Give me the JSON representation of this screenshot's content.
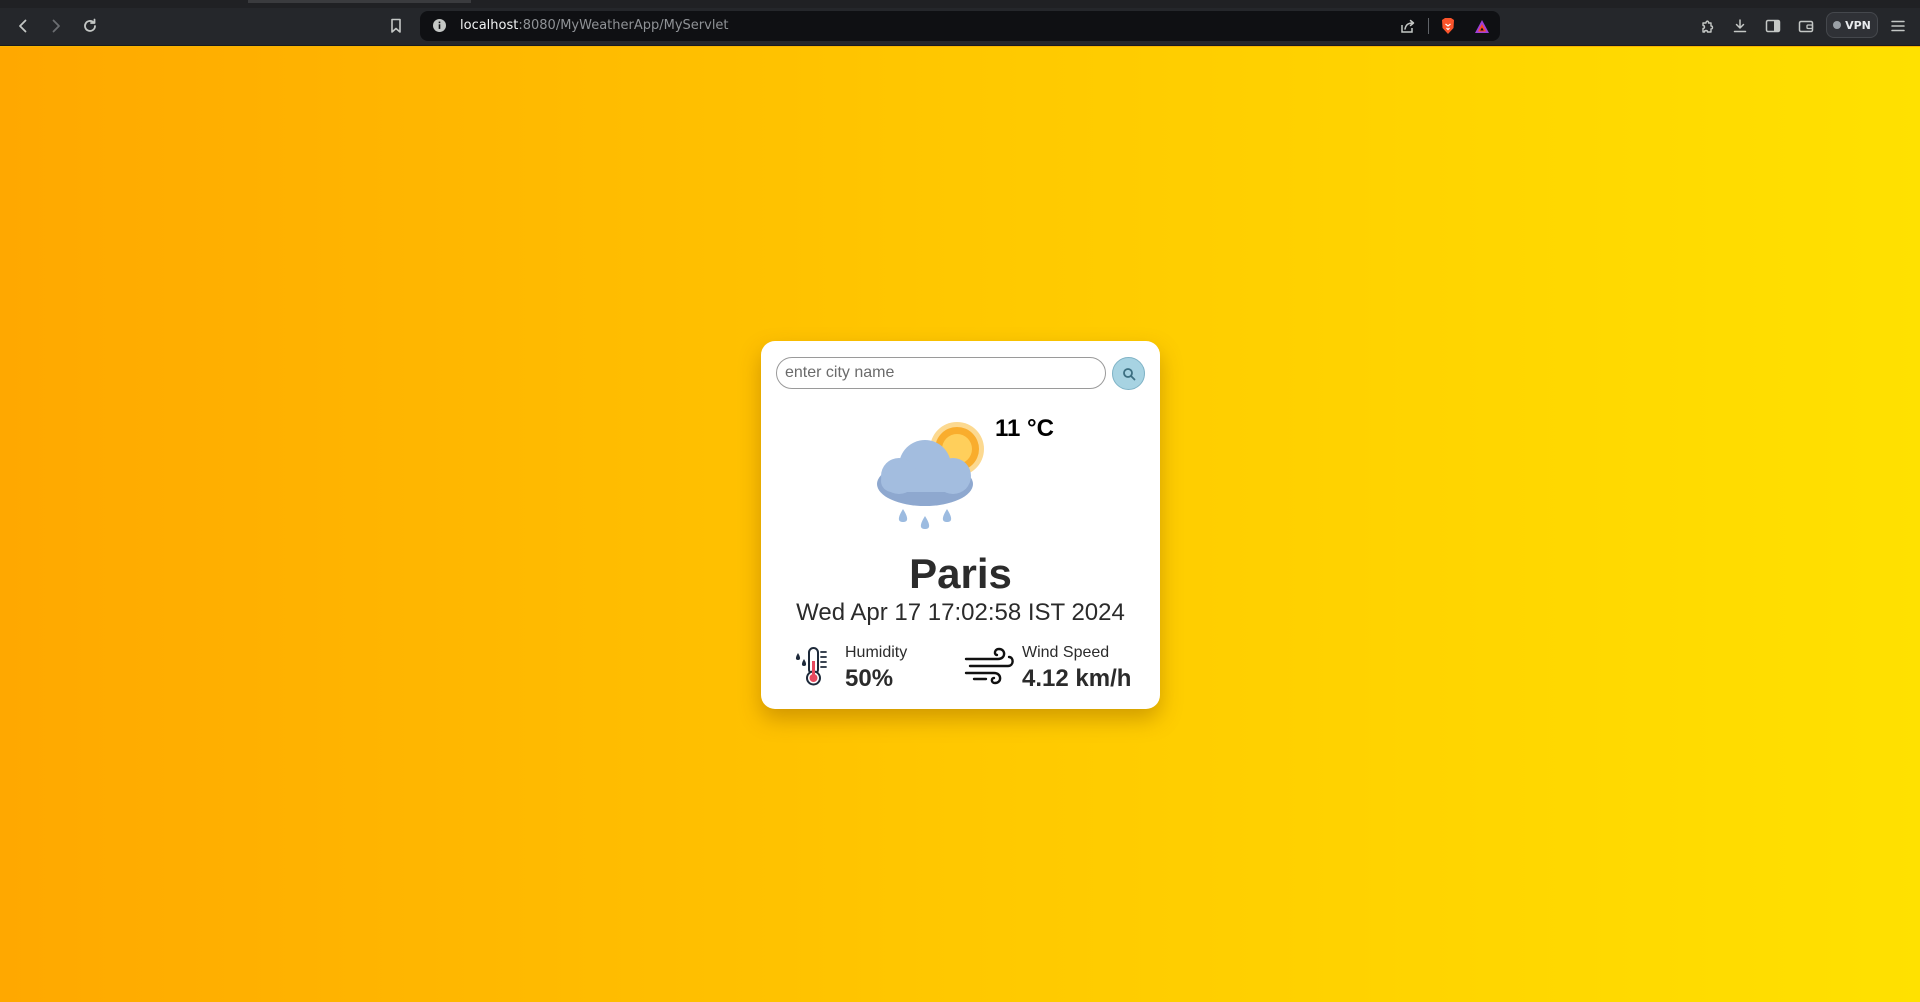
{
  "browser": {
    "url_host": "localhost",
    "url_path": ":8080/MyWeatherApp/MyServlet",
    "vpn_label": "VPN"
  },
  "search": {
    "placeholder": "enter city name",
    "value": ""
  },
  "weather": {
    "condition_icon": "partly-cloudy-rain-icon",
    "temperature": "11 °C",
    "city": "Paris",
    "datetime": "Wed Apr 17 17:02:58 IST 2024",
    "humidity_label": "Humidity",
    "humidity_value": "50%",
    "humidity_icon": "thermometer-humidity-icon",
    "wind_label": "Wind Speed",
    "wind_value": "4.12 km/h",
    "wind_icon": "wind-icon"
  },
  "colors": {
    "gradient_start": "#ffa800",
    "gradient_end": "#ffe100",
    "search_button": "#a7d3e2",
    "card_background": "#ffffff"
  }
}
